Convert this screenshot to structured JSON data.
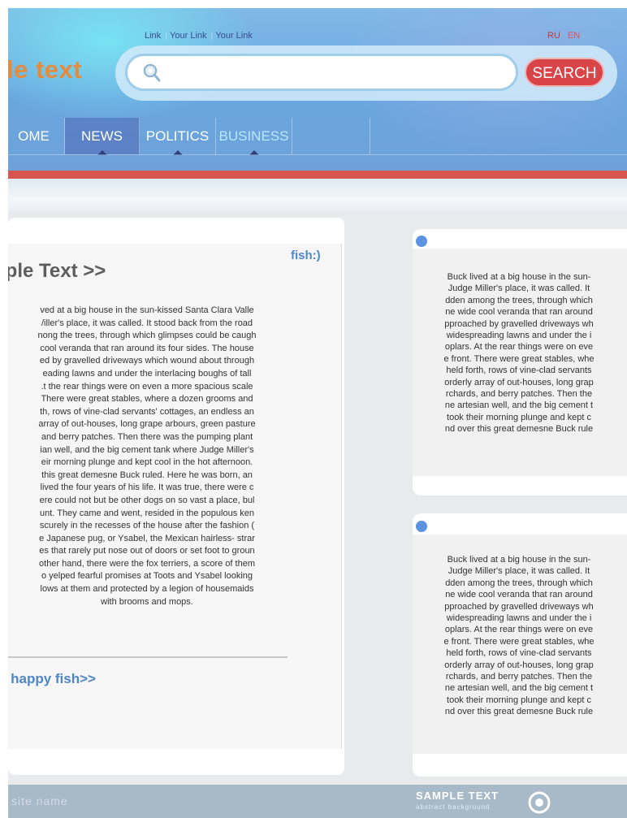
{
  "header": {
    "links": [
      "Link",
      "Your Link",
      "Your Link"
    ],
    "lang": {
      "ru": "RU",
      "en": "EN"
    },
    "site_title": "le text",
    "search": {
      "placeholder": "",
      "value": "",
      "button": "SEARCH"
    }
  },
  "nav": {
    "items": [
      {
        "label": "OME"
      },
      {
        "label": "NEWS"
      },
      {
        "label": "POLITICS"
      },
      {
        "label": "BUSINESS"
      }
    ]
  },
  "left_article": {
    "tag": "fish:)",
    "title": "nple Text  >>",
    "lines": [
      "ved at a big house in the sun-kissed Santa Clara Valle",
      "/iller's place, it was called. It stood back from the road",
      "nong the trees, through which glimpses could be caugh",
      "cool veranda that ran around its four sides. The house",
      "ed by gravelled driveways which wound about through",
      "eading lawns and under the interlacing boughs of tall",
      ".t the rear things were on even a more spacious scale",
      "There were great stables, where a dozen grooms and",
      "th, rows of vine-clad servants' cottages, an endless an",
      "array of out-houses, long grape arbours, green pasture",
      "and berry patches. Then there was the pumping plant",
      "ian well, and the big cement tank where Judge Miller's",
      "eir morning plunge and kept cool in the hot afternoon.",
      "this great demesne Buck ruled. Here he was born, an",
      "lived the four years of his life. It was true, there were c",
      "ere could not but be other dogs on so vast a place, bul",
      "unt. They came and went, resided in the populous ken",
      "scurely in the recesses of the house after the fashion (",
      "e Japanese pug, or Ysabel, the Mexican hairless- strar",
      "es that rarely put nose out of doors or set foot to groun",
      "other hand, there were the fox terriers, a score of them",
      "o yelped fearful promises at Toots and Ysabel looking",
      "lows at them and protected by a legion of housemaids",
      "with brooms and mops."
    ],
    "link": "t. happy fish>>"
  },
  "right_cards": [
    {
      "lines": [
        "Buck lived at a big house in the sun-",
        "Judge Miller's place, it was called. It",
        "dden among the trees, through which",
        "ne wide cool veranda that ran around",
        "pproached by gravelled driveways wh",
        "widespreading lawns and under the i",
        "oplars. At the rear things were on eve",
        "e front. There were great stables, whe",
        "held forth, rows of vine-clad servants",
        "orderly array of out-houses, long grap",
        "rchards, and berry patches. Then the",
        "ne artesian well, and the big cement t",
        "took their morning plunge and kept c",
        "nd over this great demesne Buck rule"
      ]
    },
    {
      "lines": [
        "Buck lived at a big house in the sun-",
        "Judge Miller's place, it was called. It",
        "dden among the trees, through which",
        "ne wide cool veranda that ran around",
        "pproached by gravelled driveways wh",
        "widespreading lawns and under the i",
        "oplars. At the rear things were on eve",
        "e front. There were great stables, whe",
        "held forth, rows of vine-clad servants",
        "orderly array of out-houses, long grap",
        "rchards, and berry patches. Then the",
        "ne artesian well, and the big cement t",
        "took their morning plunge and kept c",
        "nd over this great demesne Buck rule"
      ]
    }
  ],
  "footer": {
    "site_name": "site name",
    "brand": "SAMPLE TEXT",
    "sub": "abstract background"
  },
  "colors": {
    "accent_red": "#d94448",
    "link_blue": "#4f86c6",
    "title_orange": "#e78b3a"
  }
}
